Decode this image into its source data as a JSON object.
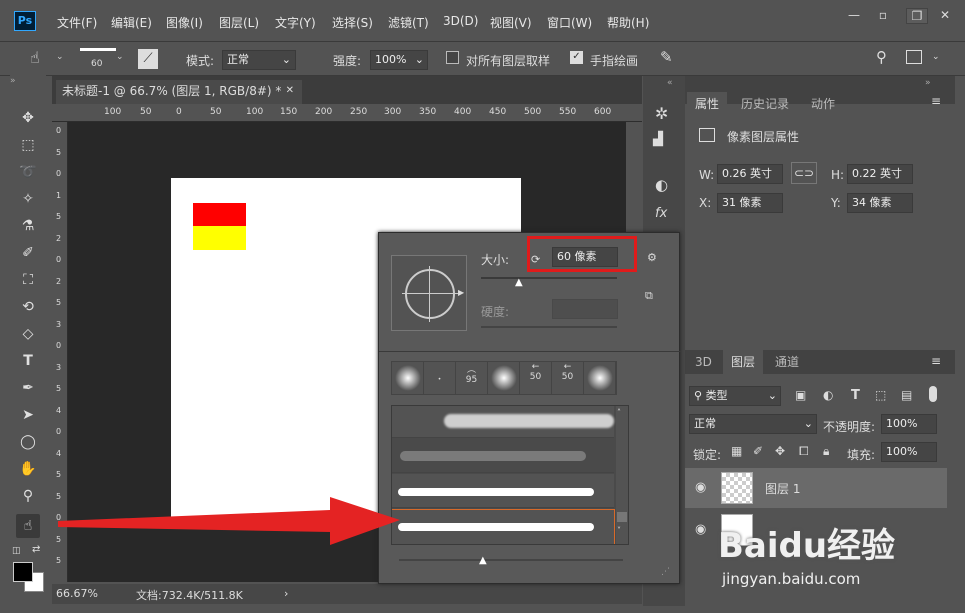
{
  "app": {
    "logo": "Ps"
  },
  "menu": [
    "文件(F)",
    "编辑(E)",
    "图像(I)",
    "图层(L)",
    "文字(Y)",
    "选择(S)",
    "滤镜(T)",
    "3D(D)",
    "视图(V)",
    "窗口(W)",
    "帮助(H)"
  ],
  "options": {
    "brush_size": "60",
    "mode_label": "模式:",
    "mode_value": "正常",
    "strength_label": "强度:",
    "strength_value": "100%",
    "sample_all_label": "对所有图层取样",
    "finger_paint_label": "手指绘画"
  },
  "document": {
    "tab_title": "未标题-1 @ 66.7% (图层 1, RGB/8#) *",
    "ruler_ticks": [
      "100",
      "50",
      "0",
      "50",
      "100",
      "150",
      "200",
      "250",
      "300",
      "350",
      "400",
      "450",
      "500",
      "550",
      "600"
    ],
    "ruler_left": [
      "0",
      "5",
      "0",
      "1",
      "5",
      "2",
      "0",
      "2",
      "5",
      "3",
      "0",
      "3",
      "5",
      "4",
      "0",
      "4",
      "5",
      "5",
      "0",
      "5",
      "5"
    ],
    "zoom": "66.67%",
    "doc_size": "文档:732.4K/511.8K"
  },
  "properties": {
    "tabs": [
      "属性",
      "历史记录",
      "动作"
    ],
    "title": "像素图层属性",
    "w_label": "W:",
    "w_value": "0.26 英寸",
    "h_label": "H:",
    "h_value": "0.22 英寸",
    "x_label": "X:",
    "x_value": "31 像素",
    "y_label": "Y:",
    "y_value": "34 像素"
  },
  "layers": {
    "tabs": [
      "3D",
      "图层",
      "通道"
    ],
    "filter_value": "类型",
    "blend_value": "正常",
    "opacity_label": "不透明度:",
    "opacity_value": "100%",
    "lock_label": "锁定:",
    "fill_label": "填充:",
    "fill_value": "100%",
    "layer1_name": "图层 1"
  },
  "brush_popup": {
    "size_label": "大小:",
    "size_value": "60 像素",
    "hardness_label": "硬度:",
    "tip_sizes": [
      "",
      "",
      "95",
      "",
      "50",
      "50",
      ""
    ]
  },
  "colors": {
    "red": "#ff0000",
    "yellow": "#ffff00",
    "highlight": "#e01b1b",
    "selected_stroke": "#d86a2a"
  },
  "watermark": {
    "logo": "Baidu经验",
    "url": "jingyan.baidu.com"
  }
}
